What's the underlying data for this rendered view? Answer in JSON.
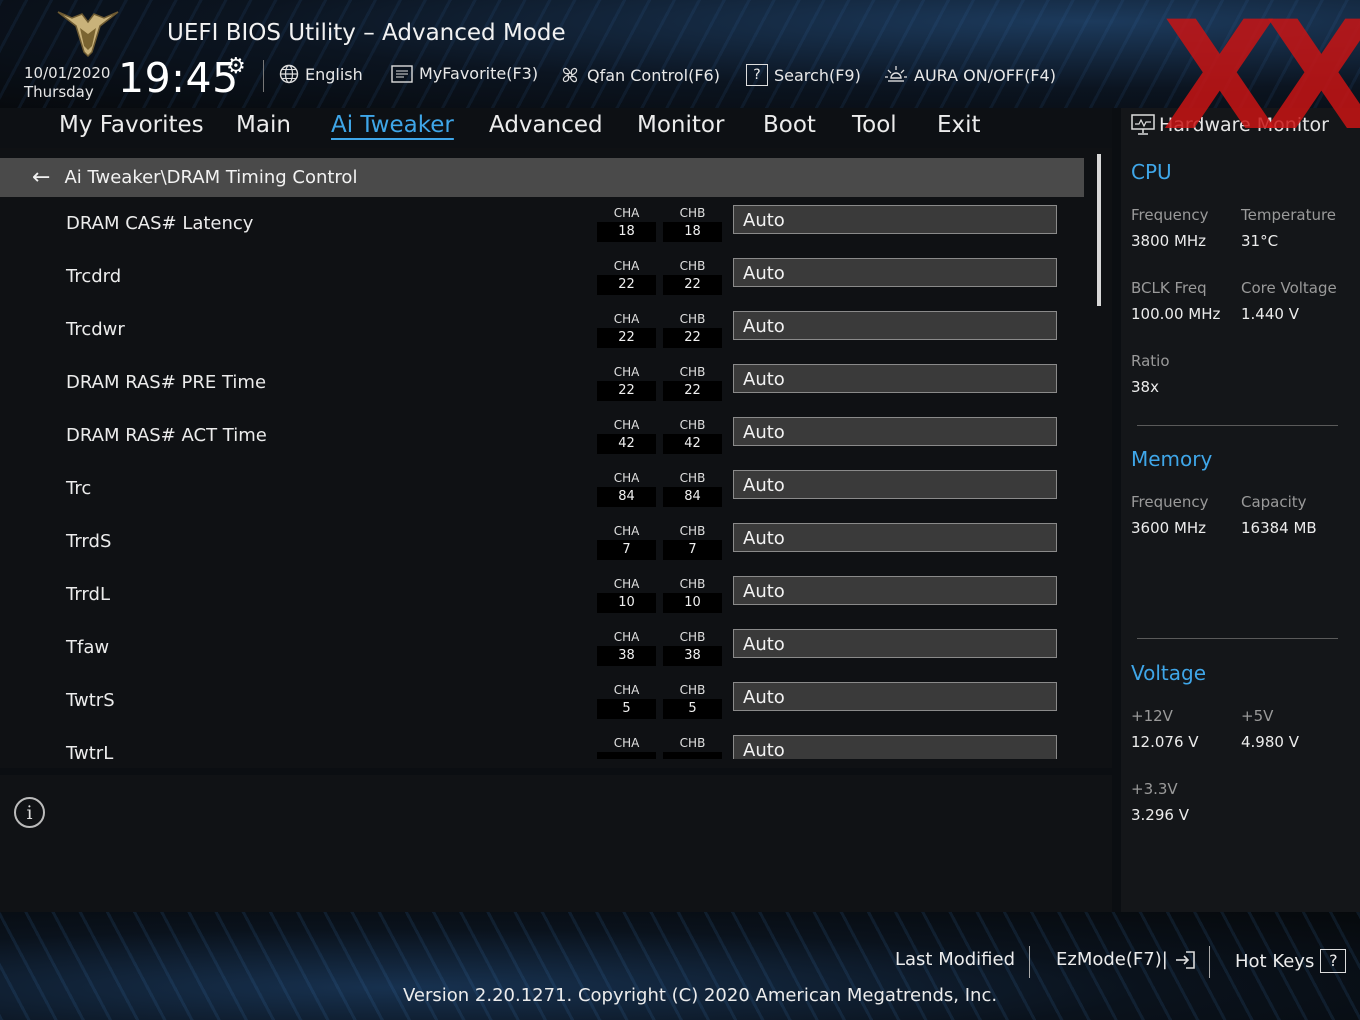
{
  "header": {
    "title": "UEFI BIOS Utility – Advanced Mode",
    "date": "10/01/2020",
    "day": "Thursday",
    "time": "19:45",
    "toolbar": {
      "language": "English",
      "myfavorite": "MyFavorite(F3)",
      "qfan": "Qfan Control(F6)",
      "search": "Search(F9)",
      "aura": "AURA ON/OFF(F4)"
    }
  },
  "nav": {
    "tabs": [
      "My Favorites",
      "Main",
      "Ai Tweaker",
      "Advanced",
      "Monitor",
      "Boot",
      "Tool",
      "Exit"
    ],
    "active": "Ai Tweaker"
  },
  "breadcrumb": "Ai Tweaker\\DRAM Timing Control",
  "channel_labels": {
    "a": "CHA",
    "b": "CHB"
  },
  "rows": [
    {
      "label": "DRAM CAS# Latency",
      "cha": "18",
      "chb": "18",
      "value": "Auto"
    },
    {
      "label": "Trcdrd",
      "cha": "22",
      "chb": "22",
      "value": "Auto"
    },
    {
      "label": "Trcdwr",
      "cha": "22",
      "chb": "22",
      "value": "Auto"
    },
    {
      "label": "DRAM RAS# PRE Time",
      "cha": "22",
      "chb": "22",
      "value": "Auto"
    },
    {
      "label": "DRAM RAS# ACT Time",
      "cha": "42",
      "chb": "42",
      "value": "Auto"
    },
    {
      "label": "Trc",
      "cha": "84",
      "chb": "84",
      "value": "Auto"
    },
    {
      "label": "TrrdS",
      "cha": "7",
      "chb": "7",
      "value": "Auto"
    },
    {
      "label": "TrrdL",
      "cha": "10",
      "chb": "10",
      "value": "Auto"
    },
    {
      "label": "Tfaw",
      "cha": "38",
      "chb": "38",
      "value": "Auto"
    },
    {
      "label": "TwtrS",
      "cha": "5",
      "chb": "5",
      "value": "Auto"
    },
    {
      "label": "TwtrL",
      "cha": "",
      "chb": "",
      "value": "Auto"
    }
  ],
  "hardware_monitor": {
    "title": "Hardware Monitor",
    "cpu": {
      "heading": "CPU",
      "frequency_label": "Frequency",
      "frequency": "3800 MHz",
      "temperature_label": "Temperature",
      "temperature": "31°C",
      "bclk_label": "BCLK Freq",
      "bclk": "100.00 MHz",
      "core_voltage_label": "Core Voltage",
      "core_voltage": "1.440 V",
      "ratio_label": "Ratio",
      "ratio": "38x"
    },
    "memory": {
      "heading": "Memory",
      "frequency_label": "Frequency",
      "frequency": "3600 MHz",
      "capacity_label": "Capacity",
      "capacity": "16384 MB"
    },
    "voltage": {
      "heading": "Voltage",
      "v12_label": "+12V",
      "v12": "12.076 V",
      "v5_label": "+5V",
      "v5": "4.980 V",
      "v33_label": "+3.3V",
      "v33": "3.296 V"
    }
  },
  "footer": {
    "last_modified": "Last Modified",
    "ezmode": "EzMode(F7)|",
    "hotkeys": "Hot Keys",
    "hotkeys_icon": "?",
    "version": "Version 2.20.1271. Copyright (C) 2020 American Megatrends, Inc."
  },
  "watermark": "XX",
  "colors": {
    "accent": "#3fa6e8",
    "watermark": "#c81414"
  }
}
